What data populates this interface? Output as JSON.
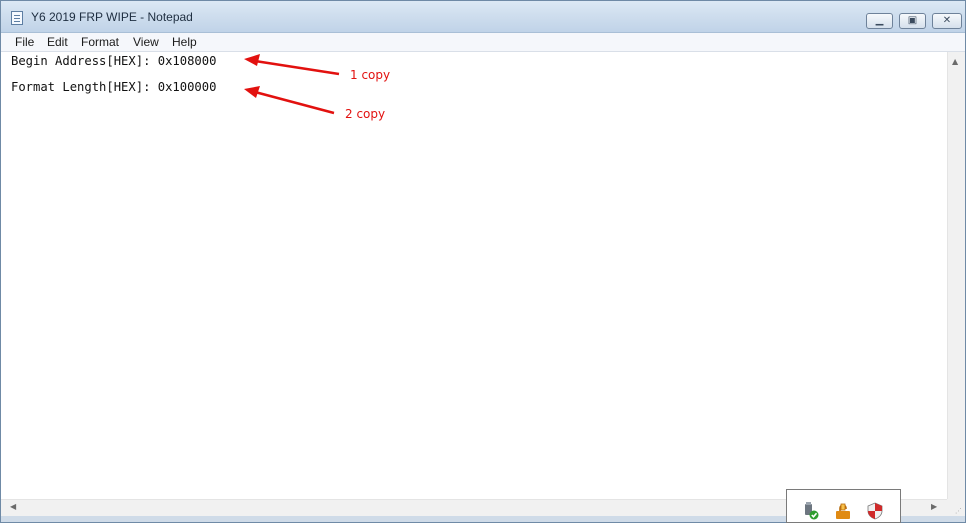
{
  "window": {
    "title": "Y6 2019 FRP WIPE - Notepad",
    "icon": "notepad-icon",
    "controls": {
      "minimize_icon": "minimize-icon",
      "maximize_icon": "maximize-icon",
      "close_icon": "close-icon",
      "minimize_glyph": "▁",
      "maximize_glyph": "▣",
      "close_glyph": "✕"
    }
  },
  "menu": {
    "items": [
      "File",
      "Edit",
      "Format",
      "View",
      "Help"
    ]
  },
  "document": {
    "lines": [
      "Begin Address[HEX]: 0x108000",
      "Format Length[HEX]: 0x100000"
    ]
  },
  "annotations": {
    "items": [
      "1 copy",
      "2 copy"
    ],
    "color": "#e2110f"
  },
  "scrollbars": {
    "up_glyph": "▲",
    "left_glyph": "◀",
    "right_glyph": "▶",
    "grip_glyph": "⋰"
  },
  "tray": {
    "icons": [
      "usb-check-icon",
      "lock-warning-icon",
      "shield-icon"
    ]
  },
  "colors": {
    "titlebar": "#cfdeee",
    "menubar": "#f5f7fb",
    "text": "#111111",
    "annotation": "#e2110f"
  }
}
